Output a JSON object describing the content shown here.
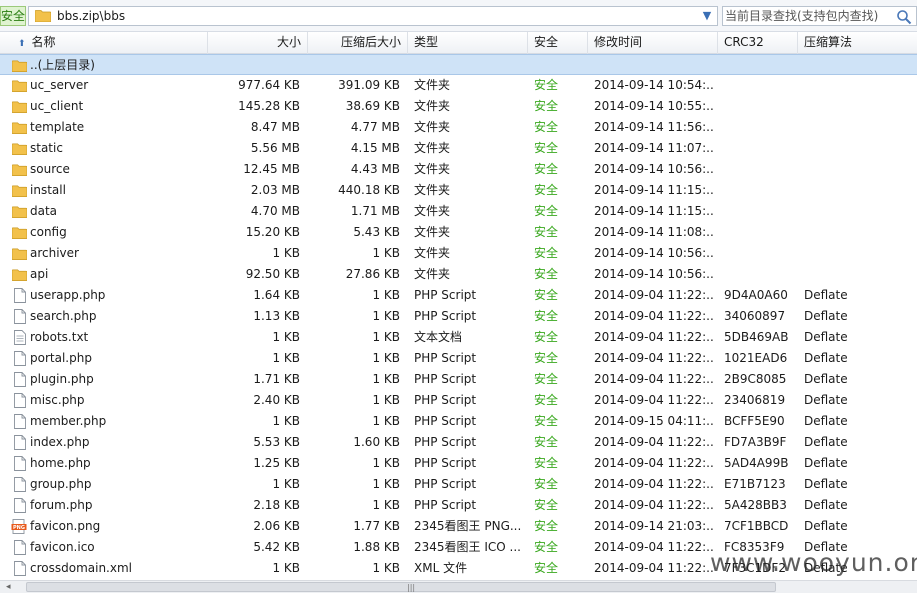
{
  "address": {
    "safe_label": "安全",
    "path": "bbs.zip\\bbs",
    "search_placeholder": "当前目录查找(支持包内查找)"
  },
  "columns": {
    "name": "名称",
    "size": "大小",
    "compressed": "压缩后大小",
    "type": "类型",
    "security": "安全",
    "modified": "修改时间",
    "crc": "CRC32",
    "method": "压缩算法"
  },
  "parent_row": {
    "name": "..(上层目录)"
  },
  "rows": [
    {
      "name": "uc_server",
      "icon": "folder-icon",
      "size": "977.64 KB",
      "compressed": "391.09 KB",
      "type": "文件夹",
      "security": "安全",
      "modified": "2014-09-14 10:54:...",
      "crc": "",
      "method": ""
    },
    {
      "name": "uc_client",
      "icon": "folder-icon",
      "size": "145.28 KB",
      "compressed": "38.69 KB",
      "type": "文件夹",
      "security": "安全",
      "modified": "2014-09-14 10:55:...",
      "crc": "",
      "method": ""
    },
    {
      "name": "template",
      "icon": "folder-icon",
      "size": "8.47 MB",
      "compressed": "4.77 MB",
      "type": "文件夹",
      "security": "安全",
      "modified": "2014-09-14 11:56:...",
      "crc": "",
      "method": ""
    },
    {
      "name": "static",
      "icon": "folder-icon",
      "size": "5.56 MB",
      "compressed": "4.15 MB",
      "type": "文件夹",
      "security": "安全",
      "modified": "2014-09-14 11:07:...",
      "crc": "",
      "method": ""
    },
    {
      "name": "source",
      "icon": "folder-icon",
      "size": "12.45 MB",
      "compressed": "4.43 MB",
      "type": "文件夹",
      "security": "安全",
      "modified": "2014-09-14 10:56:...",
      "crc": "",
      "method": ""
    },
    {
      "name": "install",
      "icon": "folder-icon",
      "size": "2.03 MB",
      "compressed": "440.18 KB",
      "type": "文件夹",
      "security": "安全",
      "modified": "2014-09-14 11:15:...",
      "crc": "",
      "method": ""
    },
    {
      "name": "data",
      "icon": "folder-icon",
      "size": "4.70 MB",
      "compressed": "1.71 MB",
      "type": "文件夹",
      "security": "安全",
      "modified": "2014-09-14 11:15:...",
      "crc": "",
      "method": ""
    },
    {
      "name": "config",
      "icon": "folder-icon",
      "size": "15.20 KB",
      "compressed": "5.43 KB",
      "type": "文件夹",
      "security": "安全",
      "modified": "2014-09-14 11:08:...",
      "crc": "",
      "method": ""
    },
    {
      "name": "archiver",
      "icon": "folder-icon",
      "size": "1 KB",
      "compressed": "1 KB",
      "type": "文件夹",
      "security": "安全",
      "modified": "2014-09-14 10:56:...",
      "crc": "",
      "method": ""
    },
    {
      "name": "api",
      "icon": "folder-icon",
      "size": "92.50 KB",
      "compressed": "27.86 KB",
      "type": "文件夹",
      "security": "安全",
      "modified": "2014-09-14 10:56:...",
      "crc": "",
      "method": ""
    },
    {
      "name": "userapp.php",
      "icon": "file-icon",
      "size": "1.64 KB",
      "compressed": "1 KB",
      "type": "PHP Script",
      "security": "安全",
      "modified": "2014-09-04 11:22:...",
      "crc": "9D4A0A60",
      "method": "Deflate"
    },
    {
      "name": "search.php",
      "icon": "file-icon",
      "size": "1.13 KB",
      "compressed": "1 KB",
      "type": "PHP Script",
      "security": "安全",
      "modified": "2014-09-04 11:22:...",
      "crc": "34060897",
      "method": "Deflate"
    },
    {
      "name": "robots.txt",
      "icon": "text-file-icon",
      "size": "1 KB",
      "compressed": "1 KB",
      "type": "文本文档",
      "security": "安全",
      "modified": "2014-09-04 11:22:...",
      "crc": "5DB469AB",
      "method": "Deflate"
    },
    {
      "name": "portal.php",
      "icon": "file-icon",
      "size": "1 KB",
      "compressed": "1 KB",
      "type": "PHP Script",
      "security": "安全",
      "modified": "2014-09-04 11:22:...",
      "crc": "1021EAD6",
      "method": "Deflate"
    },
    {
      "name": "plugin.php",
      "icon": "file-icon",
      "size": "1.71 KB",
      "compressed": "1 KB",
      "type": "PHP Script",
      "security": "安全",
      "modified": "2014-09-04 11:22:...",
      "crc": "2B9C8085",
      "method": "Deflate"
    },
    {
      "name": "misc.php",
      "icon": "file-icon",
      "size": "2.40 KB",
      "compressed": "1 KB",
      "type": "PHP Script",
      "security": "安全",
      "modified": "2014-09-04 11:22:...",
      "crc": "23406819",
      "method": "Deflate"
    },
    {
      "name": "member.php",
      "icon": "file-icon",
      "size": "1 KB",
      "compressed": "1 KB",
      "type": "PHP Script",
      "security": "安全",
      "modified": "2014-09-15 04:11:...",
      "crc": "BCFF5E90",
      "method": "Deflate"
    },
    {
      "name": "index.php",
      "icon": "file-icon",
      "size": "5.53 KB",
      "compressed": "1.60 KB",
      "type": "PHP Script",
      "security": "安全",
      "modified": "2014-09-04 11:22:...",
      "crc": "FD7A3B9F",
      "method": "Deflate"
    },
    {
      "name": "home.php",
      "icon": "file-icon",
      "size": "1.25 KB",
      "compressed": "1 KB",
      "type": "PHP Script",
      "security": "安全",
      "modified": "2014-09-04 11:22:...",
      "crc": "5AD4A99B",
      "method": "Deflate"
    },
    {
      "name": "group.php",
      "icon": "file-icon",
      "size": "1 KB",
      "compressed": "1 KB",
      "type": "PHP Script",
      "security": "安全",
      "modified": "2014-09-04 11:22:...",
      "crc": "E71B7123",
      "method": "Deflate"
    },
    {
      "name": "forum.php",
      "icon": "file-icon",
      "size": "2.18 KB",
      "compressed": "1 KB",
      "type": "PHP Script",
      "security": "安全",
      "modified": "2014-09-04 11:22:...",
      "crc": "5A428BB3",
      "method": "Deflate"
    },
    {
      "name": "favicon.png",
      "icon": "png-file-icon",
      "size": "2.06 KB",
      "compressed": "1.77 KB",
      "type": "2345看图王 PNG...",
      "security": "安全",
      "modified": "2014-09-14 21:03:...",
      "crc": "7CF1BBCD",
      "method": "Deflate"
    },
    {
      "name": "favicon.ico",
      "icon": "file-icon",
      "size": "5.42 KB",
      "compressed": "1.88 KB",
      "type": "2345看图王 ICO ...",
      "security": "安全",
      "modified": "2014-09-04 11:22:...",
      "crc": "FC8353F9",
      "method": "Deflate"
    },
    {
      "name": "crossdomain.xml",
      "icon": "file-icon",
      "size": "1 KB",
      "compressed": "1 KB",
      "type": "XML 文件",
      "security": "安全",
      "modified": "2014-09-04 11:22:...",
      "crc": "7F3C1DF2",
      "method": "Deflate"
    }
  ],
  "watermark": "www.wooyun.org",
  "colors": {
    "safe": "#3aa81f",
    "parent_row_bg": "#cfe3f7",
    "folder": "#f2c14b"
  }
}
